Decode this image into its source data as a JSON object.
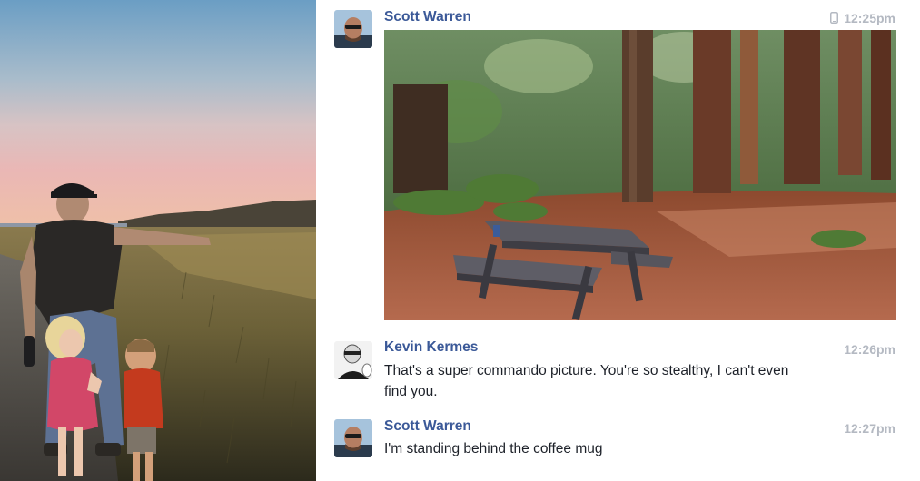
{
  "left_photo": {
    "description_icon": "family-landscape-photo"
  },
  "messages": [
    {
      "sender": "Scott Warren",
      "time": "12:25pm",
      "device_icon": "phone-icon",
      "attachment": "forest-picnic-table-photo"
    },
    {
      "sender": "Kevin Kermes",
      "time": "12:26pm",
      "text": "That's a super commando picture. You're so stealthy, I can't even find you."
    },
    {
      "sender": "Scott Warren",
      "time": "12:27pm",
      "text": "I'm standing behind the coffee mug"
    }
  ],
  "colors": {
    "sender_name": "#3b5998",
    "timestamp": "#b4b9c2",
    "message_text": "#1d2129"
  }
}
